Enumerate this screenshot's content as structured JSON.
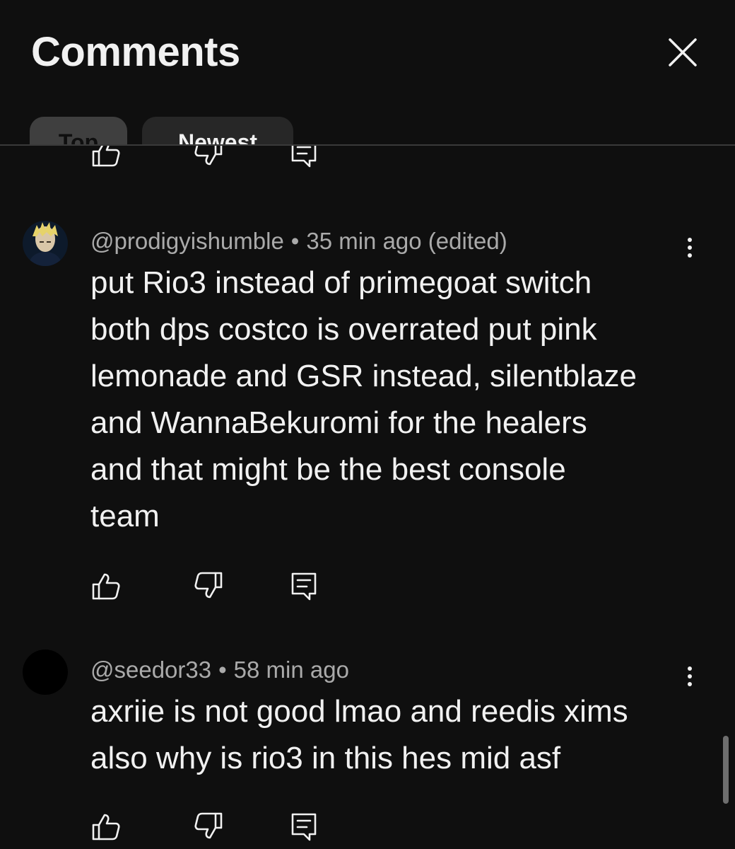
{
  "header": {
    "title": "Comments",
    "tabs": [
      {
        "label": "Top",
        "selected": true
      },
      {
        "label": "Newest",
        "selected": false
      }
    ]
  },
  "comments": [
    {
      "author": "@prodigyishumble",
      "separator": "•",
      "time": "35 min ago (edited)",
      "lines": [
        "put Rio3 instead of primegoat switch",
        "both dps costco is overrated put pink",
        "lemonade and GSR instead, silentblaze",
        "and WannaBekuromi for the healers",
        "and that might be the best console",
        "team"
      ]
    },
    {
      "author": "@seedor33",
      "separator": "•",
      "time": "58 min ago",
      "lines": [
        "axriie is not good lmao and reedis xims",
        "also why is rio3 in this hes mid asf"
      ]
    }
  ],
  "icons": {
    "close": "close-icon",
    "like": "thumbs-up-icon",
    "dislike": "thumbs-down-icon",
    "reply": "reply-icon",
    "more": "more-vertical-icon"
  },
  "colors": {
    "background": "#0f0f0f",
    "text": "#f1f1f1",
    "muted": "#aaaaaa",
    "chip_selected": "#3f3f3f",
    "chip": "#272727"
  }
}
